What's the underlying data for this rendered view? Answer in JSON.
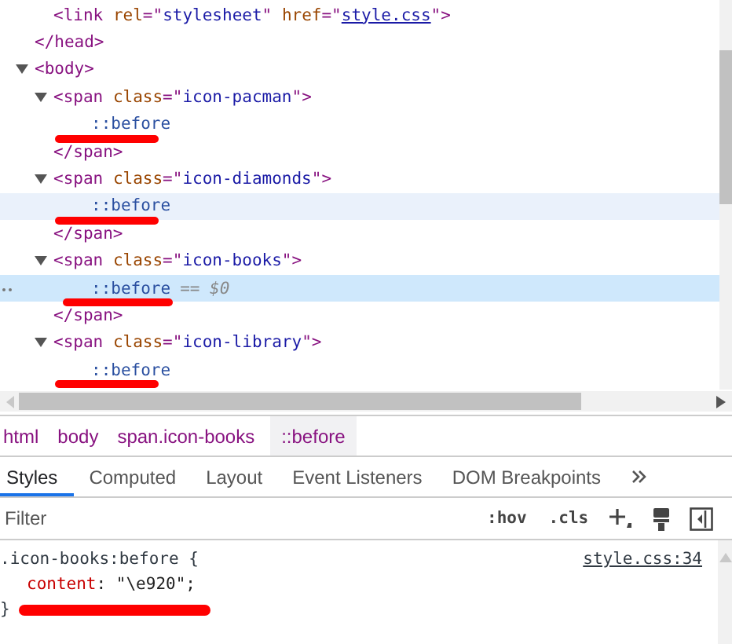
{
  "elements": {
    "tree": [
      {
        "kind": "fragment",
        "children": [
          {
            "kind": "tag",
            "tokens": [
              {
                "tag": "<link "
              },
              {
                "attr": "rel"
              },
              {
                "tag": "=\""
              },
              {
                "value": "stylesheet"
              },
              {
                "tag": "\" "
              },
              {
                "attr": "href"
              },
              {
                "tag": "=\""
              },
              {
                "link": "style.css"
              },
              {
                "tag": "\">"
              }
            ]
          }
        ],
        "close": [
          {
            "tag": "</head>"
          }
        ]
      },
      {
        "kind": "tag",
        "expanded": true,
        "tokens": [
          {
            "tag": "<body>"
          }
        ],
        "children": [
          {
            "kind": "tag",
            "expanded": true,
            "tokens": [
              {
                "tag": "<span "
              },
              {
                "attr": "class"
              },
              {
                "tag": "=\""
              },
              {
                "value": "icon-pacman"
              },
              {
                "tag": "\">"
              }
            ],
            "children": [
              {
                "kind": "pseudo",
                "text": "::before",
                "selected": false,
                "hovered": false,
                "redacted": true
              }
            ],
            "close": [
              {
                "tag": "</span>"
              }
            ]
          },
          {
            "kind": "tag",
            "expanded": true,
            "tokens": [
              {
                "tag": "<span "
              },
              {
                "attr": "class"
              },
              {
                "tag": "=\""
              },
              {
                "value": "icon-diamonds"
              },
              {
                "tag": "\">"
              }
            ],
            "children": [
              {
                "kind": "pseudo",
                "text": "::before",
                "selected": false,
                "hovered": true,
                "redacted": true
              }
            ],
            "close": [
              {
                "tag": "</span>"
              }
            ]
          },
          {
            "kind": "tag",
            "expanded": true,
            "tokens": [
              {
                "tag": "<span "
              },
              {
                "attr": "class"
              },
              {
                "tag": "=\""
              },
              {
                "value": "icon-books"
              },
              {
                "tag": "\">"
              }
            ],
            "children": [
              {
                "kind": "pseudo",
                "text": "::before",
                "note": "== $0",
                "selected": true,
                "hovered": false,
                "redacted": true
              }
            ],
            "close": [
              {
                "tag": "</span>"
              }
            ]
          },
          {
            "kind": "tag",
            "expanded": true,
            "tokens": [
              {
                "tag": "<span "
              },
              {
                "attr": "class"
              },
              {
                "tag": "=\""
              },
              {
                "value": "icon-library"
              },
              {
                "tag": "\">"
              }
            ],
            "children": [
              {
                "kind": "pseudo",
                "text": "::before",
                "selected": false,
                "hovered": false,
                "redacted": true
              }
            ]
          }
        ]
      }
    ]
  },
  "breadcrumbs": [
    {
      "label": "html",
      "selected": false
    },
    {
      "label": "body",
      "selected": false
    },
    {
      "label": "span.icon-books",
      "selected": false
    },
    {
      "label": "::before",
      "selected": true
    }
  ],
  "tabs": [
    {
      "label": "Styles",
      "selected": true
    },
    {
      "label": "Computed",
      "selected": false
    },
    {
      "label": "Layout",
      "selected": false
    },
    {
      "label": "Event Listeners",
      "selected": false
    },
    {
      "label": "DOM Breakpoints",
      "selected": false
    }
  ],
  "filter": {
    "placeholder": "Filter",
    "hov": ":hov",
    "cls": ".cls"
  },
  "rule": {
    "selector": ".icon-books:before {",
    "source": "style.css:34",
    "declarations": [
      {
        "property": "content",
        "colon": ": ",
        "value": "\"\\e920\";"
      }
    ],
    "close": "}",
    "redacted": true
  }
}
